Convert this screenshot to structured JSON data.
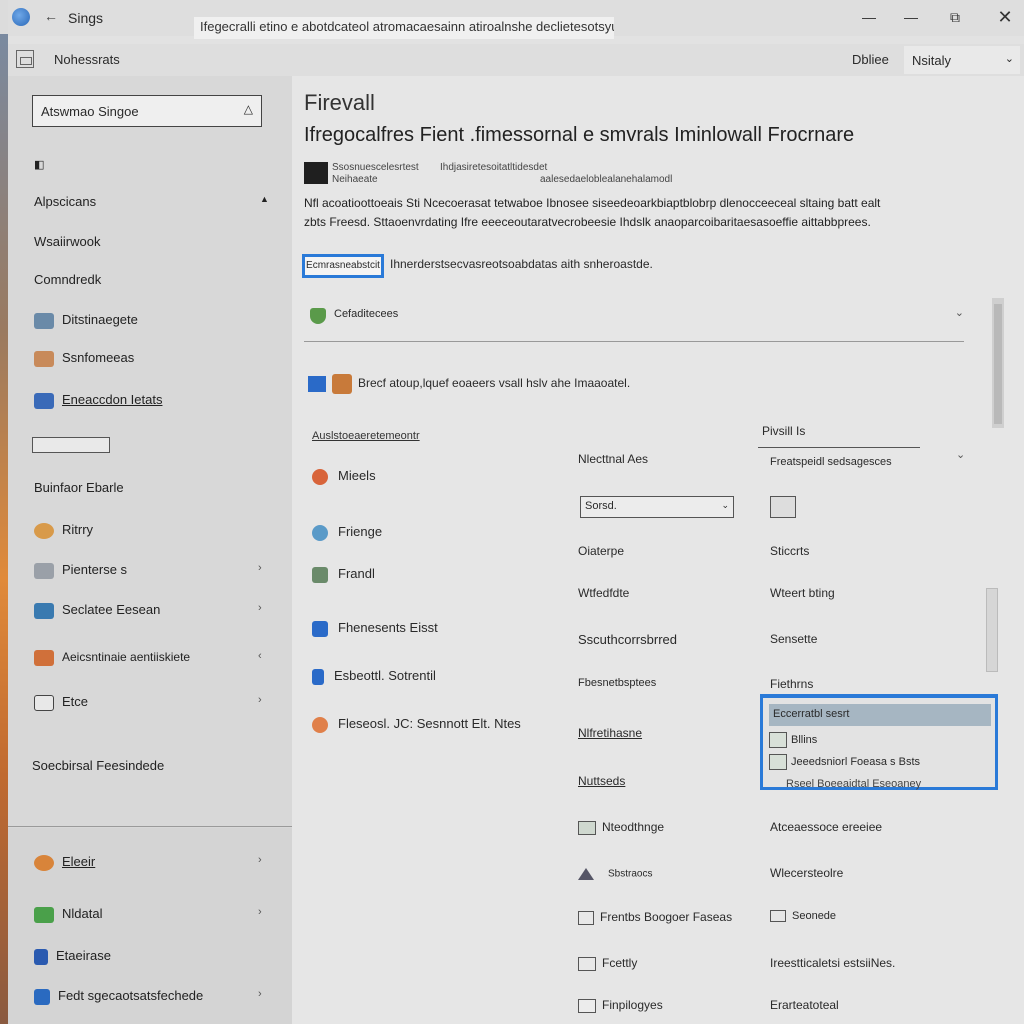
{
  "window": {
    "title": "Sings",
    "path": "Ifegecralli etino e abotdcateol atromacaesainn atiroalnshe declietesotsyuce",
    "controls": {
      "minimize": "—",
      "restore": "—",
      "maximize": "⧉",
      "close": "✕"
    }
  },
  "toolbar": {
    "label": "Nohessrats",
    "right_label": "Dbliee",
    "select_value": "Nsitaly"
  },
  "sidebar": {
    "search_placeholder": "Atswmao Singoe",
    "items": [
      {
        "label": "Alpscicans"
      },
      {
        "label": "Wsaiirwook"
      },
      {
        "label": "Comndredk"
      },
      {
        "label": "Ditstinaegete"
      },
      {
        "label": "Ssnfomeeas"
      },
      {
        "label": "Eneaccdon Ietats"
      },
      {
        "label": "Buinfaor Ebarle"
      },
      {
        "label": "Ritrry"
      },
      {
        "label": "Pienterse s"
      },
      {
        "label": "Seclatee Eesean"
      },
      {
        "label": "Aeicsntinaie aentiiskiete"
      },
      {
        "label": "Etce"
      },
      {
        "label": "Soecbirsal Feesindede"
      },
      {
        "label": "Eleeir"
      },
      {
        "label": "Nldatal"
      },
      {
        "label": "Etaeirase"
      },
      {
        "label": "Fedt sgecaotsatsfechede"
      }
    ]
  },
  "main": {
    "heading": "Firevall",
    "subheading": "Ifregocalfres Fient .fimessornal e smvrals Iminlowall Frocrnare",
    "meta1_line1": "Ssosnuescelesrtest",
    "meta1_line2": "Neihaeate",
    "meta2_line1": "Ihdjasiretesoitatltidesdet",
    "meta2_line2": "aalesedaeloblealanehalamodl",
    "description": "Nfl acoatioottoeais Sti Ncecoerasat tetwaboe Ibnosee siseedeoarkbiaptblobrp dlenocceeceal sltaing batt ealt zbts Freesd. Sttaoenvrdating Ifre eeeceoutaratvecrobeesie Ihdslk anaoparcoibaritaesasoeffie aittabbprees.",
    "action_button": "Ecmrasneabstcit",
    "action_text": "Ihnerderstsecvasreotsoabdatas aith snheroastde.",
    "accordion_label": "Cefaditecees",
    "allow_text": "Brecf atoup,lquef eoaeers vsall hslv ahe Imaaoatel.",
    "col_head": "Auslstoeaeretemeontr",
    "apps": [
      {
        "label": "Mieels"
      },
      {
        "label": "Frienge"
      },
      {
        "label": "Frandl"
      },
      {
        "label": "Fhenesents Eisst"
      },
      {
        "label": "Esbeottl. Sotrentil"
      },
      {
        "label": "Fleseosl. JC: Sesnnott Elt. Ntes"
      }
    ],
    "mid": {
      "head": "Nlecttnal Aes",
      "select_value": "Sorsd.",
      "items": [
        {
          "label": "Oiaterpe"
        },
        {
          "label": "Wtfedfdte"
        },
        {
          "label": "Sscuthcorrsbrred"
        },
        {
          "label": "Fbesnetbsptees"
        },
        {
          "label": "Nlfretihasne"
        },
        {
          "label": "Nuttseds"
        },
        {
          "label": "Nteodthnge"
        },
        {
          "label": "Sbstraocs"
        },
        {
          "label": "Frentbs Boogoer Faseas"
        },
        {
          "label": "Fcettly"
        },
        {
          "label": "Finpilogyes"
        }
      ]
    },
    "right": {
      "head": "Pivsill Is",
      "sub": "Freatspeidl sedsagesces",
      "items": [
        {
          "label": "Sticcrts"
        },
        {
          "label": "Wteert bting"
        },
        {
          "label": "Sensette"
        },
        {
          "label": "Fiethrns"
        },
        {
          "label": "Atceaessoce ereeiee"
        },
        {
          "label": "Wlecersteolre"
        },
        {
          "label": "Seonede"
        },
        {
          "label": "Ireestticaletsi estsiiNes."
        },
        {
          "label": "Erarteatoteal"
        }
      ],
      "dropdown": {
        "selected": "Eccerratbl sesrt",
        "options": [
          {
            "label": "Bllins"
          },
          {
            "label": "Jeeedsniorl Foeasa s Bsts"
          }
        ],
        "footnote": "Rseel Boeeaidtal Eseoaney"
      }
    }
  },
  "colors": {
    "accent": "#2a7ad8",
    "highlight": "#a6b6c2"
  }
}
